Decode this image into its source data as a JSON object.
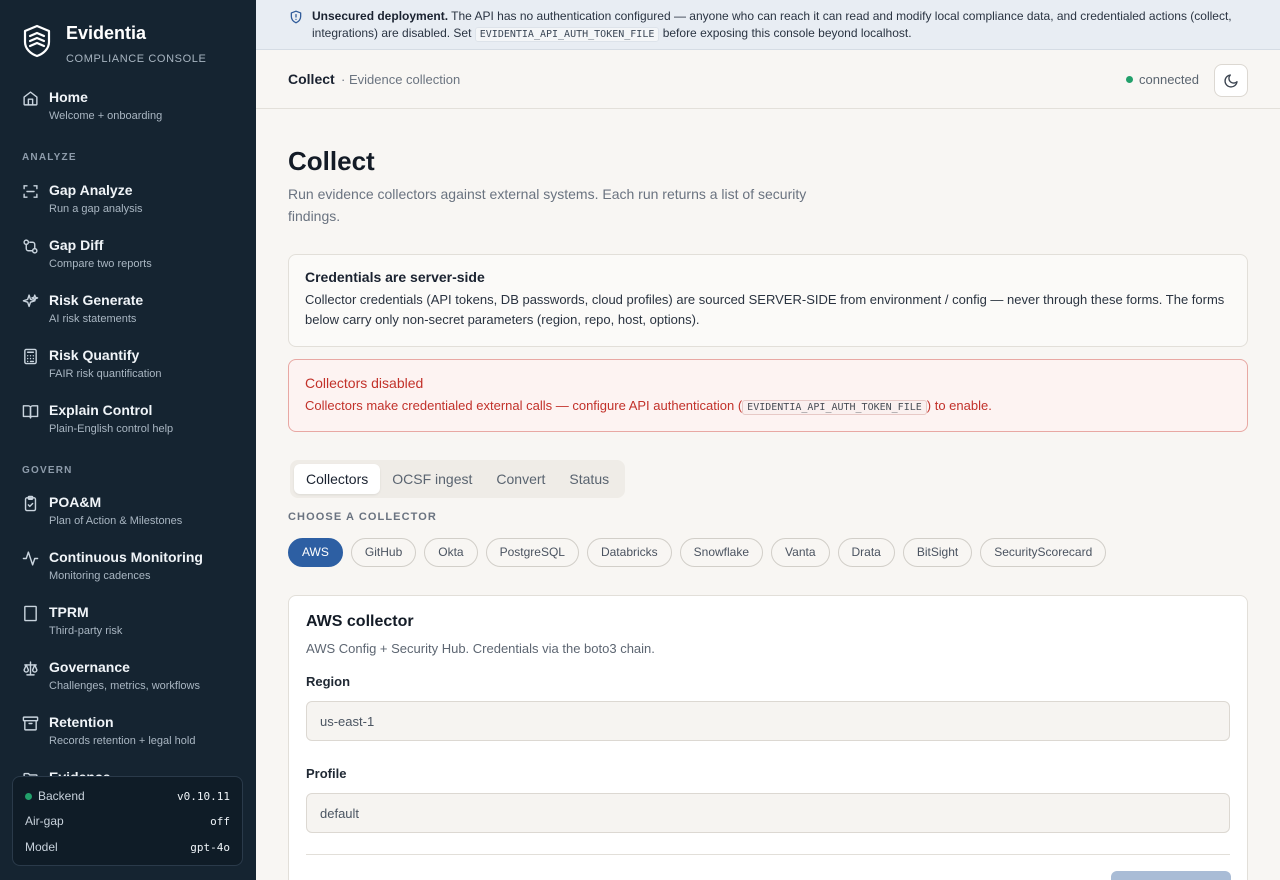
{
  "brand": {
    "name": "Evidentia",
    "subtitle": "COMPLIANCE CONSOLE"
  },
  "sidebar": {
    "home": {
      "label": "Home",
      "sub": "Welcome + onboarding",
      "icon": "home-icon"
    },
    "sections": [
      {
        "title": "ANALYZE",
        "items": [
          {
            "label": "Gap Analyze",
            "sub": "Run a gap analysis",
            "icon": "scan-icon"
          },
          {
            "label": "Gap Diff",
            "sub": "Compare two reports",
            "icon": "git-compare-icon"
          },
          {
            "label": "Risk Generate",
            "sub": "AI risk statements",
            "icon": "sparkles-icon"
          },
          {
            "label": "Risk Quantify",
            "sub": "FAIR risk quantification",
            "icon": "calculator-icon"
          },
          {
            "label": "Explain Control",
            "sub": "Plain-English control help",
            "icon": "book-open-icon"
          }
        ]
      },
      {
        "title": "GOVERN",
        "items": [
          {
            "label": "POA&M",
            "sub": "Plan of Action & Milestones",
            "icon": "clipboard-check-icon"
          },
          {
            "label": "Continuous Monitoring",
            "sub": "Monitoring cadences",
            "icon": "activity-icon"
          },
          {
            "label": "TPRM",
            "sub": "Third-party risk",
            "icon": "building-icon"
          },
          {
            "label": "Governance",
            "sub": "Challenges, metrics, workflows",
            "icon": "scale-icon"
          },
          {
            "label": "Retention",
            "sub": "Records retention + legal hold",
            "icon": "archive-icon"
          },
          {
            "label": "Evidence",
            "sub": "",
            "icon": "folder-icon"
          }
        ]
      }
    ],
    "status": [
      {
        "label": "Backend",
        "value": "v0.10.11"
      },
      {
        "label": "Air-gap",
        "value": "off"
      },
      {
        "label": "Model",
        "value": "gpt-4o"
      }
    ]
  },
  "banner": {
    "bold": "Unsecured deployment.",
    "text1": " The API has no authentication configured — anyone who can reach it can read and modify local compliance data, and credentialed actions (collect, integrations) are disabled. Set ",
    "code": "EVIDENTIA_API_AUTH_TOKEN_FILE",
    "text2": " before exposing this console beyond localhost."
  },
  "topbar": {
    "title": "Collect",
    "subtitle": "· Evidence collection",
    "connection": "connected"
  },
  "page": {
    "title": "Collect",
    "description": "Run evidence collectors against external systems. Each run returns a list of security findings."
  },
  "info_card": {
    "title": "Credentials are server-side",
    "body": "Collector credentials (API tokens, DB passwords, cloud profiles) are sourced SERVER-SIDE from environment / config — never through these forms. The forms below carry only non-secret parameters (region, repo, host, options)."
  },
  "error_card": {
    "title": "Collectors disabled",
    "text1": "Collectors make credentialed external calls — configure API authentication (",
    "code": "EVIDENTIA_API_AUTH_TOKEN_FILE",
    "text2": ") to enable."
  },
  "tabs": [
    "Collectors",
    "OCSF ingest",
    "Convert",
    "Status"
  ],
  "active_tab": "Collectors",
  "collectors": {
    "label": "CHOOSE A COLLECTOR",
    "options": [
      "AWS",
      "GitHub",
      "Okta",
      "PostgreSQL",
      "Databricks",
      "Snowflake",
      "Vanta",
      "Drata",
      "BitSight",
      "SecurityScorecard"
    ],
    "selected": "AWS"
  },
  "form": {
    "title": "AWS collector",
    "description": "AWS Config + Security Hub. Credentials via the boto3 chain.",
    "fields": [
      {
        "label": "Region",
        "value": "us-east-1"
      },
      {
        "label": "Profile",
        "value": "default"
      }
    ]
  },
  "colors": {
    "sidebar_bg": "#152431",
    "accent": "#2d5fa3",
    "error": "#c2312a",
    "success": "#22a06b"
  }
}
